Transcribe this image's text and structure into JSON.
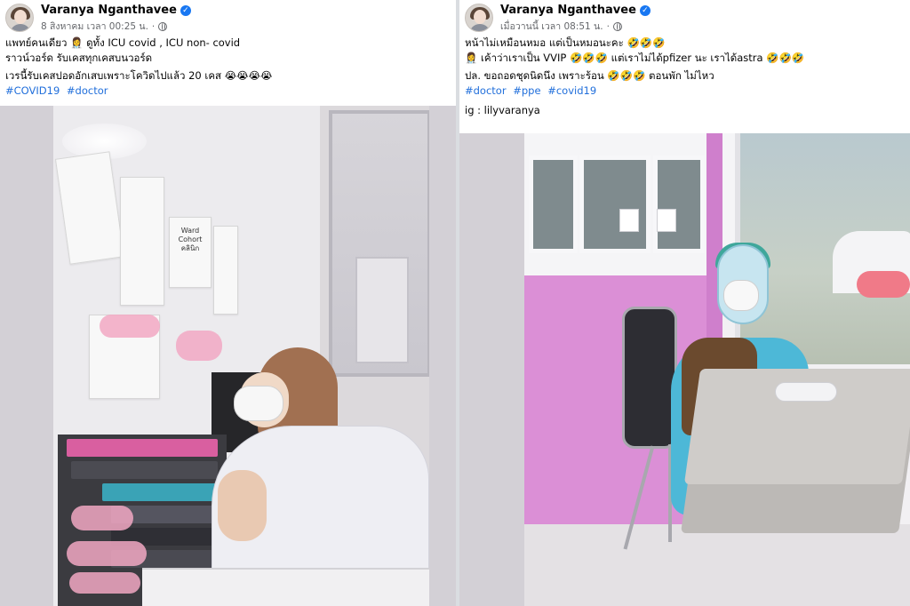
{
  "left_post": {
    "author": "Varanya Nganthavee",
    "timestamp": "8 สิงหาคม เวลา 00:25 น.",
    "caption_line1": "แพทย์คนเดียว 👩‍⚕️ ดูทั้ง ICU covid , ICU non- covid",
    "caption_line2": "ราวน์วอร์ด รับเคสทุกเคสบนวอร์ด",
    "caption_line3": "เวรนี้รับเคสปอดอักเสบเพราะโควิดไปแล้ว 20 เคส 😭😭😭😭",
    "hashtags": [
      "#COVID19",
      "#doctor"
    ],
    "photo_sign_text": "Ward\nCohort\nคลินิก"
  },
  "right_post": {
    "author": "Varanya Nganthavee",
    "timestamp": "เมื่อวานนี้ เวลา 08:51 น.",
    "caption_line1": "หน้าไม่เหมือนหมอ แต่เป็นหมอนะคะ 🤣🤣🤣",
    "caption_line2": "👩‍⚕️ เค้าว่าเราเป็น VVIP 🤣🤣🤣 แต่เราไม่ได้pfizer นะ เราได้astra 🤣🤣🤣",
    "caption_line3": "ปล. ขอถอดชุดนิดนึง เพราะร้อน 🤣🤣🤣 ตอนพัก ไม่ไหว",
    "hashtags": [
      "#doctor",
      "#ppe",
      "#covid19"
    ],
    "ig_line": "ig : lilyvaranya"
  },
  "icons": {
    "verified": "verified-badge-icon",
    "audience": "globe-icon"
  },
  "colors": {
    "hashtag": "#216fdb",
    "verified": "#1877f2",
    "meta_text": "#65676b"
  }
}
